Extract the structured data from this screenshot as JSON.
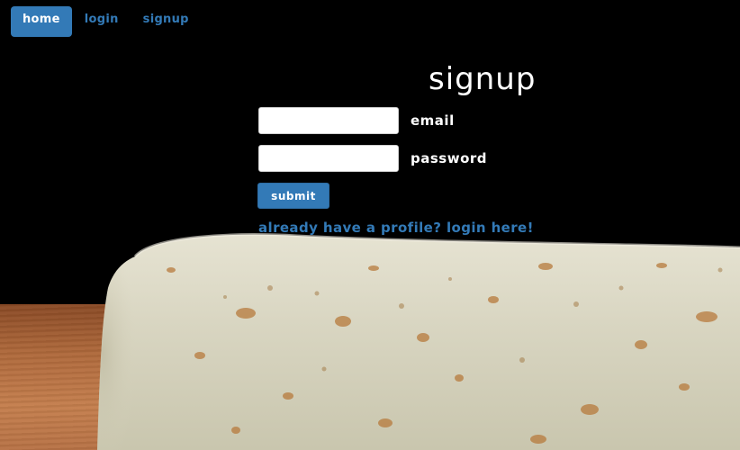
{
  "nav": {
    "home": "Home",
    "login": "Login",
    "signup": "Signup"
  },
  "form": {
    "title": "Signup",
    "email_label": "Email",
    "email_value": "",
    "password_label": "Password",
    "password_value": "",
    "submit_label": "Submit",
    "login_link": "Already Have a Profile? Login Here!"
  },
  "colors": {
    "accent": "#337ab7",
    "background": "#000000",
    "text": "#ffffff"
  },
  "background_image": {
    "subject": "burrito on wooden table"
  }
}
